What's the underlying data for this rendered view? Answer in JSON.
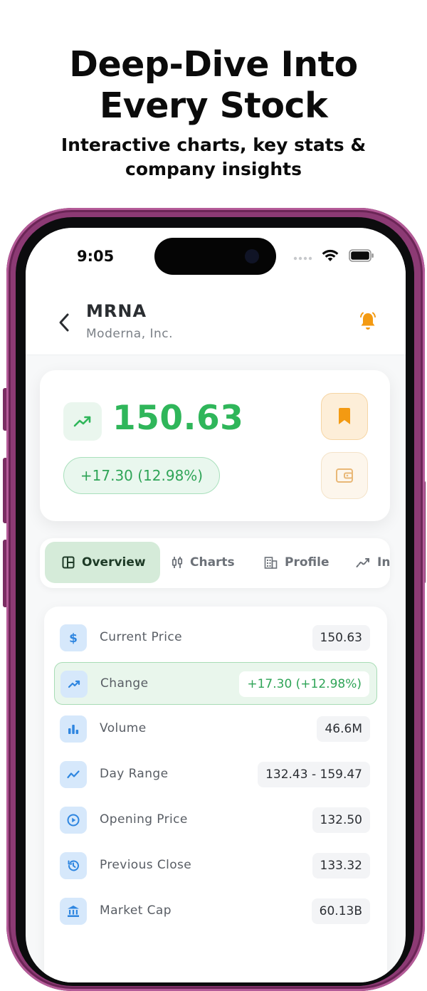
{
  "promo": {
    "headline_line1": "Deep-Dive Into",
    "headline_line2": "Every Stock",
    "subtitle_line1": "Interactive charts, key stats &",
    "subtitle_line2": "company insights"
  },
  "status_bar": {
    "time": "9:05",
    "icons": [
      "signal-dots-icon",
      "wifi-icon",
      "battery-icon"
    ]
  },
  "header": {
    "ticker": "MRNA",
    "company": "Moderna, Inc.",
    "back_icon": "chevron-left-icon",
    "alert_icon": "bell-icon"
  },
  "quote": {
    "price": "150.63",
    "change": "+17.30 (12.98%)",
    "trend_icon": "trending-up-icon",
    "bookmark_icon": "bookmark-icon",
    "wallet_icon": "wallet-icon"
  },
  "tabs": [
    {
      "label": "Overview",
      "icon": "layout-icon",
      "active": true
    },
    {
      "label": "Charts",
      "icon": "candlestick-icon",
      "active": false
    },
    {
      "label": "Profile",
      "icon": "building-icon",
      "active": false
    },
    {
      "label": "In",
      "icon": "insights-icon",
      "active": false
    }
  ],
  "stats": [
    {
      "label": "Current Price",
      "value": "150.63",
      "icon": "dollar-icon"
    },
    {
      "label": "Change",
      "value": "+17.30 (+12.98%)",
      "icon": "trending-up-icon",
      "highlighted": true
    },
    {
      "label": "Volume",
      "value": "46.6M",
      "icon": "bar-chart-icon"
    },
    {
      "label": "Day Range",
      "value": "132.43 - 159.47",
      "icon": "line-chart-icon"
    },
    {
      "label": "Opening Price",
      "value": "132.50",
      "icon": "play-circle-icon"
    },
    {
      "label": "Previous Close",
      "value": "133.32",
      "icon": "history-icon"
    },
    {
      "label": "Market Cap",
      "value": "60.13B",
      "icon": "bank-icon"
    }
  ],
  "colors": {
    "accent_green": "#2fb65a",
    "accent_orange": "#f39a12",
    "icon_blue": "#2f86e0",
    "phone_frame": "#8c3a74"
  }
}
